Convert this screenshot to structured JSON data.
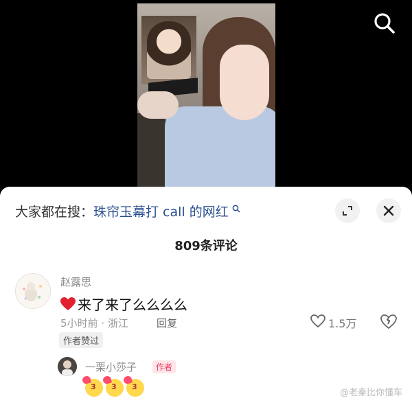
{
  "hot_search": {
    "prefix": "大家都在搜：",
    "query": "珠帘玉幕打 call 的网红",
    "mini_icon": "magnifier-glyph"
  },
  "comment_count": "809条评论",
  "comments": [
    {
      "username": "赵露思",
      "text": "来了来了么么么么",
      "time_location": "5小时前 · 浙江",
      "reply_label": "回复",
      "likes": "1.5万",
      "author_liked": "作者赞过"
    }
  ],
  "reply": {
    "username": "一栗小莎子",
    "badge": "作者"
  },
  "icons": {
    "top_search": "search-icon",
    "expand": "expand-icon",
    "close": "close-icon",
    "heart": "heart-icon",
    "like": "heart-outline-icon",
    "dislike": "broken-heart-icon"
  },
  "watermark": "@老秦比你懂车",
  "colors": {
    "link": "#2a4f8f",
    "badge_bg": "#ffe5ea",
    "badge_fg": "#e53b5c"
  }
}
